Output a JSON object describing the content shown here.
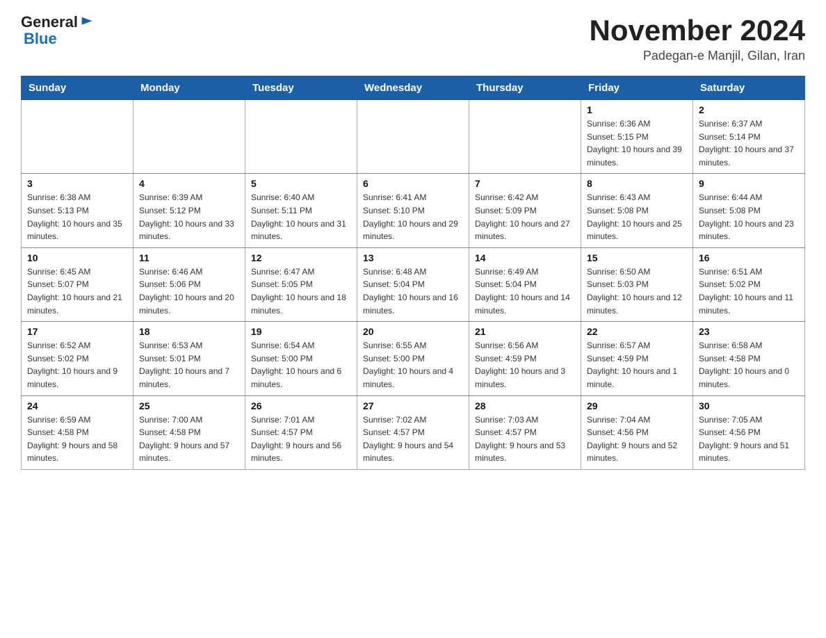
{
  "header": {
    "logo_general": "General",
    "logo_blue": "Blue",
    "month_title": "November 2024",
    "location": "Padegan-e Manjil, Gilan, Iran"
  },
  "days_of_week": [
    "Sunday",
    "Monday",
    "Tuesday",
    "Wednesday",
    "Thursday",
    "Friday",
    "Saturday"
  ],
  "weeks": [
    [
      {
        "day": "",
        "sunrise": "",
        "sunset": "",
        "daylight": ""
      },
      {
        "day": "",
        "sunrise": "",
        "sunset": "",
        "daylight": ""
      },
      {
        "day": "",
        "sunrise": "",
        "sunset": "",
        "daylight": ""
      },
      {
        "day": "",
        "sunrise": "",
        "sunset": "",
        "daylight": ""
      },
      {
        "day": "",
        "sunrise": "",
        "sunset": "",
        "daylight": ""
      },
      {
        "day": "1",
        "sunrise": "Sunrise: 6:36 AM",
        "sunset": "Sunset: 5:15 PM",
        "daylight": "Daylight: 10 hours and 39 minutes."
      },
      {
        "day": "2",
        "sunrise": "Sunrise: 6:37 AM",
        "sunset": "Sunset: 5:14 PM",
        "daylight": "Daylight: 10 hours and 37 minutes."
      }
    ],
    [
      {
        "day": "3",
        "sunrise": "Sunrise: 6:38 AM",
        "sunset": "Sunset: 5:13 PM",
        "daylight": "Daylight: 10 hours and 35 minutes."
      },
      {
        "day": "4",
        "sunrise": "Sunrise: 6:39 AM",
        "sunset": "Sunset: 5:12 PM",
        "daylight": "Daylight: 10 hours and 33 minutes."
      },
      {
        "day": "5",
        "sunrise": "Sunrise: 6:40 AM",
        "sunset": "Sunset: 5:11 PM",
        "daylight": "Daylight: 10 hours and 31 minutes."
      },
      {
        "day": "6",
        "sunrise": "Sunrise: 6:41 AM",
        "sunset": "Sunset: 5:10 PM",
        "daylight": "Daylight: 10 hours and 29 minutes."
      },
      {
        "day": "7",
        "sunrise": "Sunrise: 6:42 AM",
        "sunset": "Sunset: 5:09 PM",
        "daylight": "Daylight: 10 hours and 27 minutes."
      },
      {
        "day": "8",
        "sunrise": "Sunrise: 6:43 AM",
        "sunset": "Sunset: 5:08 PM",
        "daylight": "Daylight: 10 hours and 25 minutes."
      },
      {
        "day": "9",
        "sunrise": "Sunrise: 6:44 AM",
        "sunset": "Sunset: 5:08 PM",
        "daylight": "Daylight: 10 hours and 23 minutes."
      }
    ],
    [
      {
        "day": "10",
        "sunrise": "Sunrise: 6:45 AM",
        "sunset": "Sunset: 5:07 PM",
        "daylight": "Daylight: 10 hours and 21 minutes."
      },
      {
        "day": "11",
        "sunrise": "Sunrise: 6:46 AM",
        "sunset": "Sunset: 5:06 PM",
        "daylight": "Daylight: 10 hours and 20 minutes."
      },
      {
        "day": "12",
        "sunrise": "Sunrise: 6:47 AM",
        "sunset": "Sunset: 5:05 PM",
        "daylight": "Daylight: 10 hours and 18 minutes."
      },
      {
        "day": "13",
        "sunrise": "Sunrise: 6:48 AM",
        "sunset": "Sunset: 5:04 PM",
        "daylight": "Daylight: 10 hours and 16 minutes."
      },
      {
        "day": "14",
        "sunrise": "Sunrise: 6:49 AM",
        "sunset": "Sunset: 5:04 PM",
        "daylight": "Daylight: 10 hours and 14 minutes."
      },
      {
        "day": "15",
        "sunrise": "Sunrise: 6:50 AM",
        "sunset": "Sunset: 5:03 PM",
        "daylight": "Daylight: 10 hours and 12 minutes."
      },
      {
        "day": "16",
        "sunrise": "Sunrise: 6:51 AM",
        "sunset": "Sunset: 5:02 PM",
        "daylight": "Daylight: 10 hours and 11 minutes."
      }
    ],
    [
      {
        "day": "17",
        "sunrise": "Sunrise: 6:52 AM",
        "sunset": "Sunset: 5:02 PM",
        "daylight": "Daylight: 10 hours and 9 minutes."
      },
      {
        "day": "18",
        "sunrise": "Sunrise: 6:53 AM",
        "sunset": "Sunset: 5:01 PM",
        "daylight": "Daylight: 10 hours and 7 minutes."
      },
      {
        "day": "19",
        "sunrise": "Sunrise: 6:54 AM",
        "sunset": "Sunset: 5:00 PM",
        "daylight": "Daylight: 10 hours and 6 minutes."
      },
      {
        "day": "20",
        "sunrise": "Sunrise: 6:55 AM",
        "sunset": "Sunset: 5:00 PM",
        "daylight": "Daylight: 10 hours and 4 minutes."
      },
      {
        "day": "21",
        "sunrise": "Sunrise: 6:56 AM",
        "sunset": "Sunset: 4:59 PM",
        "daylight": "Daylight: 10 hours and 3 minutes."
      },
      {
        "day": "22",
        "sunrise": "Sunrise: 6:57 AM",
        "sunset": "Sunset: 4:59 PM",
        "daylight": "Daylight: 10 hours and 1 minute."
      },
      {
        "day": "23",
        "sunrise": "Sunrise: 6:58 AM",
        "sunset": "Sunset: 4:58 PM",
        "daylight": "Daylight: 10 hours and 0 minutes."
      }
    ],
    [
      {
        "day": "24",
        "sunrise": "Sunrise: 6:59 AM",
        "sunset": "Sunset: 4:58 PM",
        "daylight": "Daylight: 9 hours and 58 minutes."
      },
      {
        "day": "25",
        "sunrise": "Sunrise: 7:00 AM",
        "sunset": "Sunset: 4:58 PM",
        "daylight": "Daylight: 9 hours and 57 minutes."
      },
      {
        "day": "26",
        "sunrise": "Sunrise: 7:01 AM",
        "sunset": "Sunset: 4:57 PM",
        "daylight": "Daylight: 9 hours and 56 minutes."
      },
      {
        "day": "27",
        "sunrise": "Sunrise: 7:02 AM",
        "sunset": "Sunset: 4:57 PM",
        "daylight": "Daylight: 9 hours and 54 minutes."
      },
      {
        "day": "28",
        "sunrise": "Sunrise: 7:03 AM",
        "sunset": "Sunset: 4:57 PM",
        "daylight": "Daylight: 9 hours and 53 minutes."
      },
      {
        "day": "29",
        "sunrise": "Sunrise: 7:04 AM",
        "sunset": "Sunset: 4:56 PM",
        "daylight": "Daylight: 9 hours and 52 minutes."
      },
      {
        "day": "30",
        "sunrise": "Sunrise: 7:05 AM",
        "sunset": "Sunset: 4:56 PM",
        "daylight": "Daylight: 9 hours and 51 minutes."
      }
    ]
  ]
}
